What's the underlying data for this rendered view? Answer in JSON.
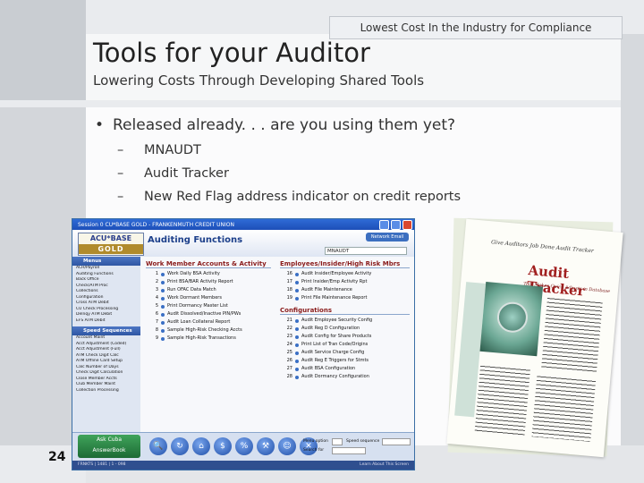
{
  "slide": {
    "banner": "Lowest Cost In the Industry for Compliance",
    "title": "Tools for your Auditor",
    "subtitle": "Lowering Costs Through Developing Shared Tools",
    "bullet": "Released already. . . are you using them yet?",
    "bullet_marker": "•",
    "sub_marker": "–",
    "sub_bullets": [
      "MNAUDT",
      "Audit Tracker",
      "New Red Flag address indicator on credit reports"
    ],
    "slide_number": "24"
  },
  "app": {
    "window_title": "Session 0 CU*BASE GOLD - FRANKENMUTH CREDIT UNION",
    "logo_top": "ACU*BASE",
    "logo_bottom": "GOLD",
    "functions_title": "Auditing Functions",
    "top_button": "Network Email",
    "top_field_value": "MNAUDT",
    "sidebar": {
      "menus_header": "Menus",
      "menus": [
        "ACH/Payroll",
        "Auditing Functions",
        "Back Office",
        "Check/ATM Proc",
        "Collections",
        "Configuration",
        "Cross ATM Debit",
        "CU Check Processing",
        "Delnqy ATM Debit",
        "EFS ATM Debit"
      ],
      "speed_header": "Speed Sequences",
      "speed": [
        "Account Maint",
        "Acct Adjustment (Coded)",
        "Acct Adjustment (Full)",
        "ATM Check Digit Calc",
        "ATM Offline Card Setup",
        "Calc Number of Days",
        "Check Digit Calculation",
        "Close Member Accts",
        "Club Member Maint",
        "Collection Processing"
      ]
    },
    "work_header": "Work Member Accounts & Activity",
    "work_items": [
      {
        "n": "1",
        "label": "Work Daily BSA Activity"
      },
      {
        "n": "2",
        "label": "Print BSA/BAR Activity Report"
      },
      {
        "n": "3",
        "label": "Run OFAC Data Match"
      },
      {
        "n": "4",
        "label": "Work Dormant Members"
      },
      {
        "n": "5",
        "label": "Print Dormancy Master List"
      },
      {
        "n": "6",
        "label": "Audit Dissolved/Inactive PIN/PWs"
      },
      {
        "n": "7",
        "label": "Audit Loan Collateral Report"
      },
      {
        "n": "8",
        "label": "Sample High-Risk Checking Accts"
      },
      {
        "n": "9",
        "label": "Sample High-Risk Transactions"
      }
    ],
    "emp_header": "Employees/Insider/High Risk Mbrs",
    "emp_items": [
      {
        "n": "16",
        "label": "Audit Insider/Employee Activity"
      },
      {
        "n": "17",
        "label": "Print Insider/Emp Activity Rpt"
      },
      {
        "n": "18",
        "label": "Audit File Maintenance"
      },
      {
        "n": "19",
        "label": "Print File Maintenance Report"
      }
    ],
    "config_header": "Configurations",
    "config_items": [
      {
        "n": "21",
        "label": "Audit Employee Security Config"
      },
      {
        "n": "22",
        "label": "Audit Reg D Configuration"
      },
      {
        "n": "23",
        "label": "Audit Config for Share Products"
      },
      {
        "n": "24",
        "label": "Print List of Tran Code/Origins"
      },
      {
        "n": "25",
        "label": "Audit Service Charge Config"
      },
      {
        "n": "26",
        "label": "Audit Reg E Triggers for Stmts"
      },
      {
        "n": "27",
        "label": "Audit BSA Configuration"
      },
      {
        "n": "28",
        "label": "Audit Dormancy Configuration"
      }
    ],
    "ask_label_top": "Ask Cuba",
    "ask_label_bottom": "AnswerBook",
    "tool_icons": [
      "magnifier-icon",
      "refresh-icon",
      "home-icon",
      "money-icon",
      "percent-icon",
      "tools-icon",
      "person-icon",
      "close-icon"
    ],
    "tool_glyphs": [
      "🔍",
      "↻",
      "⌂",
      "$",
      "%",
      "⚒",
      "☺",
      "✕"
    ],
    "menu_option_label": "Menu option",
    "speed_sequence_label": "Speed sequence",
    "search_for_label": "Search for",
    "status_left": "FRNKTS | 1481 | 1 - 098",
    "status_right": "Learn About This Screen"
  },
  "brochure": {
    "top_line": "Give Auditors Job Done Audit Tracker",
    "title": "Audit Tracker",
    "subtitle": "Tool Makes Quick Adjusts in Database"
  }
}
